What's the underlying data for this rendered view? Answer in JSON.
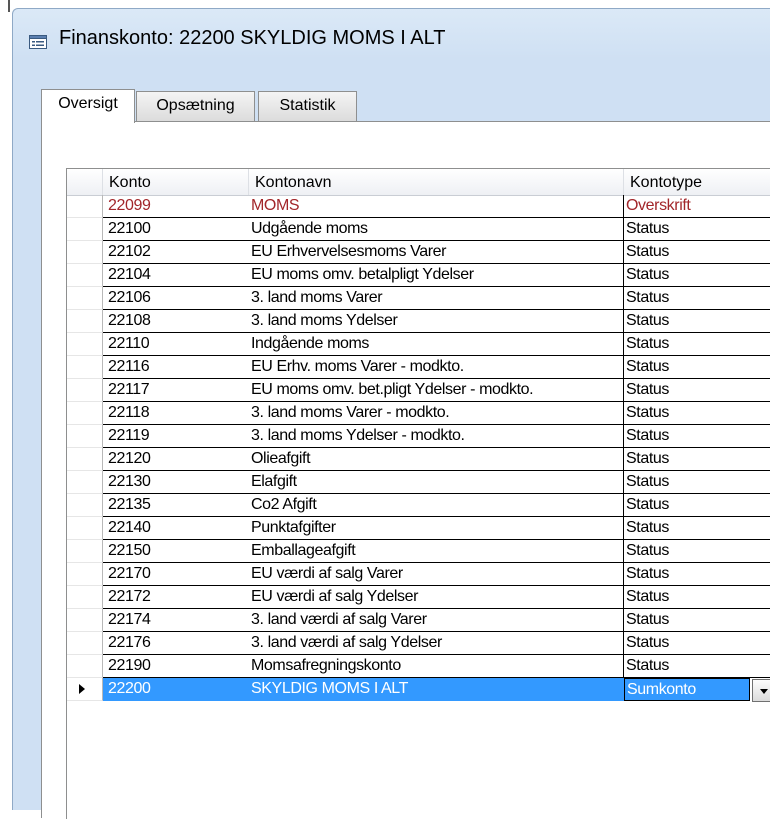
{
  "window": {
    "title": "Finanskonto: 22200   SKYLDIG MOMS I ALT",
    "icon": "form-icon"
  },
  "tabs": [
    {
      "label": "Oversigt",
      "active": true
    },
    {
      "label": "Opsætning",
      "active": false
    },
    {
      "label": "Statistik",
      "active": false
    }
  ],
  "table": {
    "columns": [
      "Konto",
      "Kontonavn",
      "Kontotype"
    ],
    "rows": [
      {
        "konto": "22099",
        "kontonavn": "MOMS",
        "kontotype": "Overskrift"
      },
      {
        "konto": "22100",
        "kontonavn": "Udgående moms",
        "kontotype": "Status"
      },
      {
        "konto": "22102",
        "kontonavn": "EU Erhvervelsesmoms Varer",
        "kontotype": "Status"
      },
      {
        "konto": "22104",
        "kontonavn": "EU moms omv. betalpligt Ydelser",
        "kontotype": "Status"
      },
      {
        "konto": "22106",
        "kontonavn": "3. land moms Varer",
        "kontotype": "Status"
      },
      {
        "konto": "22108",
        "kontonavn": "3. land moms Ydelser",
        "kontotype": "Status"
      },
      {
        "konto": "22110",
        "kontonavn": "Indgående moms",
        "kontotype": "Status"
      },
      {
        "konto": "22116",
        "kontonavn": "EU Erhv. moms Varer - modkto.",
        "kontotype": "Status"
      },
      {
        "konto": "22117",
        "kontonavn": "EU moms omv. bet.pligt Ydelser - modkto.",
        "kontotype": "Status"
      },
      {
        "konto": "22118",
        "kontonavn": "3. land moms Varer - modkto.",
        "kontotype": "Status"
      },
      {
        "konto": "22119",
        "kontonavn": "3. land moms Ydelser - modkto.",
        "kontotype": "Status"
      },
      {
        "konto": "22120",
        "kontonavn": "Olieafgift",
        "kontotype": "Status"
      },
      {
        "konto": "22130",
        "kontonavn": "Elafgift",
        "kontotype": "Status"
      },
      {
        "konto": "22135",
        "kontonavn": "Co2 Afgift",
        "kontotype": "Status"
      },
      {
        "konto": "22140",
        "kontonavn": "Punktafgifter",
        "kontotype": "Status"
      },
      {
        "konto": "22150",
        "kontonavn": "Emballageafgift",
        "kontotype": "Status"
      },
      {
        "konto": "22170",
        "kontonavn": "EU værdi af salg Varer",
        "kontotype": "Status"
      },
      {
        "konto": "22172",
        "kontonavn": "EU værdi af salg Ydelser",
        "kontotype": "Status"
      },
      {
        "konto": "22174",
        "kontonavn": "3. land værdi af salg Varer",
        "kontotype": "Status"
      },
      {
        "konto": "22176",
        "kontonavn": "3. land værdi af salg Ydelser",
        "kontotype": "Status"
      },
      {
        "konto": "22190",
        "kontonavn": "Momsafregningskonto",
        "kontotype": "Status"
      },
      {
        "konto": "22200",
        "kontonavn": "SKYLDIG MOMS I ALT",
        "kontotype": "Sumkonto",
        "selected": true
      }
    ]
  },
  "colors": {
    "heading_text": "#a2262a",
    "selection": "#3399ff"
  }
}
